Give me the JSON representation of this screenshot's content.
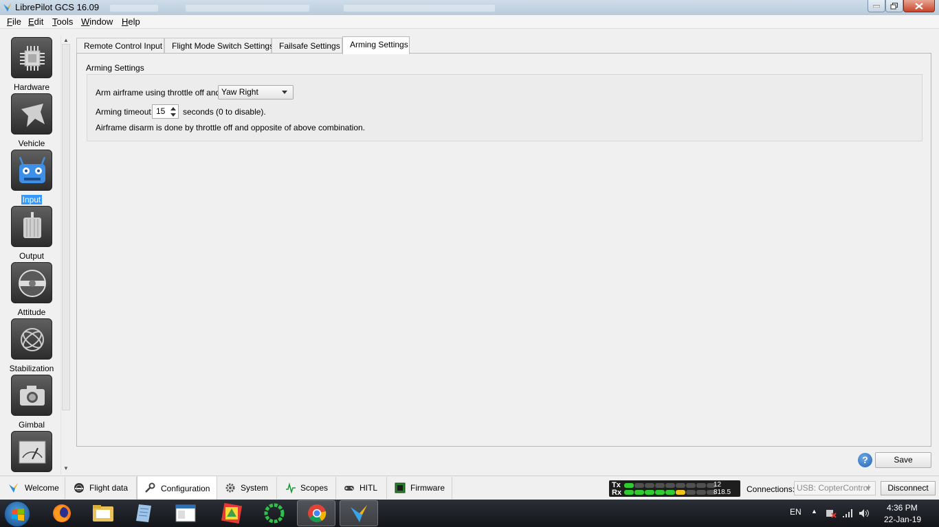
{
  "window": {
    "title": "LibrePilot GCS 16.09"
  },
  "menu": [
    {
      "first": "F",
      "rest": "ile"
    },
    {
      "first": "E",
      "rest": "dit"
    },
    {
      "first": "T",
      "rest": "ools"
    },
    {
      "first": "W",
      "rest": "indow"
    },
    {
      "first": "H",
      "rest": "elp"
    }
  ],
  "sidebar": {
    "items": [
      {
        "label": "Hardware",
        "icon": "chip-icon"
      },
      {
        "label": "Vehicle",
        "icon": "airframe-icon"
      },
      {
        "label": "Input",
        "icon": "radio-transmitter-icon",
        "selected": true
      },
      {
        "label": "Output",
        "icon": "motor-icon"
      },
      {
        "label": "Attitude",
        "icon": "level-icon"
      },
      {
        "label": "Stabilization",
        "icon": "gyro-icon"
      },
      {
        "label": "Gimbal",
        "icon": "camera-icon"
      },
      {
        "label": "",
        "icon": "gauge-icon"
      }
    ]
  },
  "tabs": [
    {
      "label": "Remote Control Input"
    },
    {
      "label": "Flight Mode Switch Settings"
    },
    {
      "label": "Failsafe Settings"
    },
    {
      "label": "Arming Settings",
      "active": true
    }
  ],
  "arming": {
    "group_title": "Arming Settings",
    "arm_label": "Arm airframe using throttle off and:",
    "arm_value": "Yaw Right",
    "timeout_label": "Arming timeout:",
    "timeout_value": "15",
    "timeout_suffix": "seconds (0 to disable).",
    "disarm_note": "Airframe disarm is done by throttle off and opposite of above combination."
  },
  "actions": {
    "help": "?",
    "save": "Save"
  },
  "modes": [
    {
      "label": "Welcome",
      "icon": "librepilot-logo-icon"
    },
    {
      "label": "Flight data",
      "icon": "attitude-indicator-icon"
    },
    {
      "label": "Configuration",
      "icon": "wrench-icon",
      "active": true
    },
    {
      "label": "System",
      "icon": "gear-icon"
    },
    {
      "label": "Scopes",
      "icon": "waveform-icon"
    },
    {
      "label": "HITL",
      "icon": "gamepad-icon"
    },
    {
      "label": "Firmware",
      "icon": "board-icon"
    }
  ],
  "telemetry": {
    "tx_label": "Tx",
    "rx_label": "Rx",
    "tx_value": "12",
    "rx_value": "818.5",
    "tx_bars_lit": 1,
    "rx_bars_lit": 6,
    "bars_total": 9,
    "color_green": "#2ecc2e",
    "color_yellow": "#f0c419",
    "color_off": "#505050"
  },
  "connection": {
    "label": "Connections:",
    "value": "USB: CopterControl",
    "disconnect": "Disconnect"
  },
  "taskbar": {
    "language": "EN",
    "time": "4:36 PM",
    "date": "22-Jan-19"
  }
}
